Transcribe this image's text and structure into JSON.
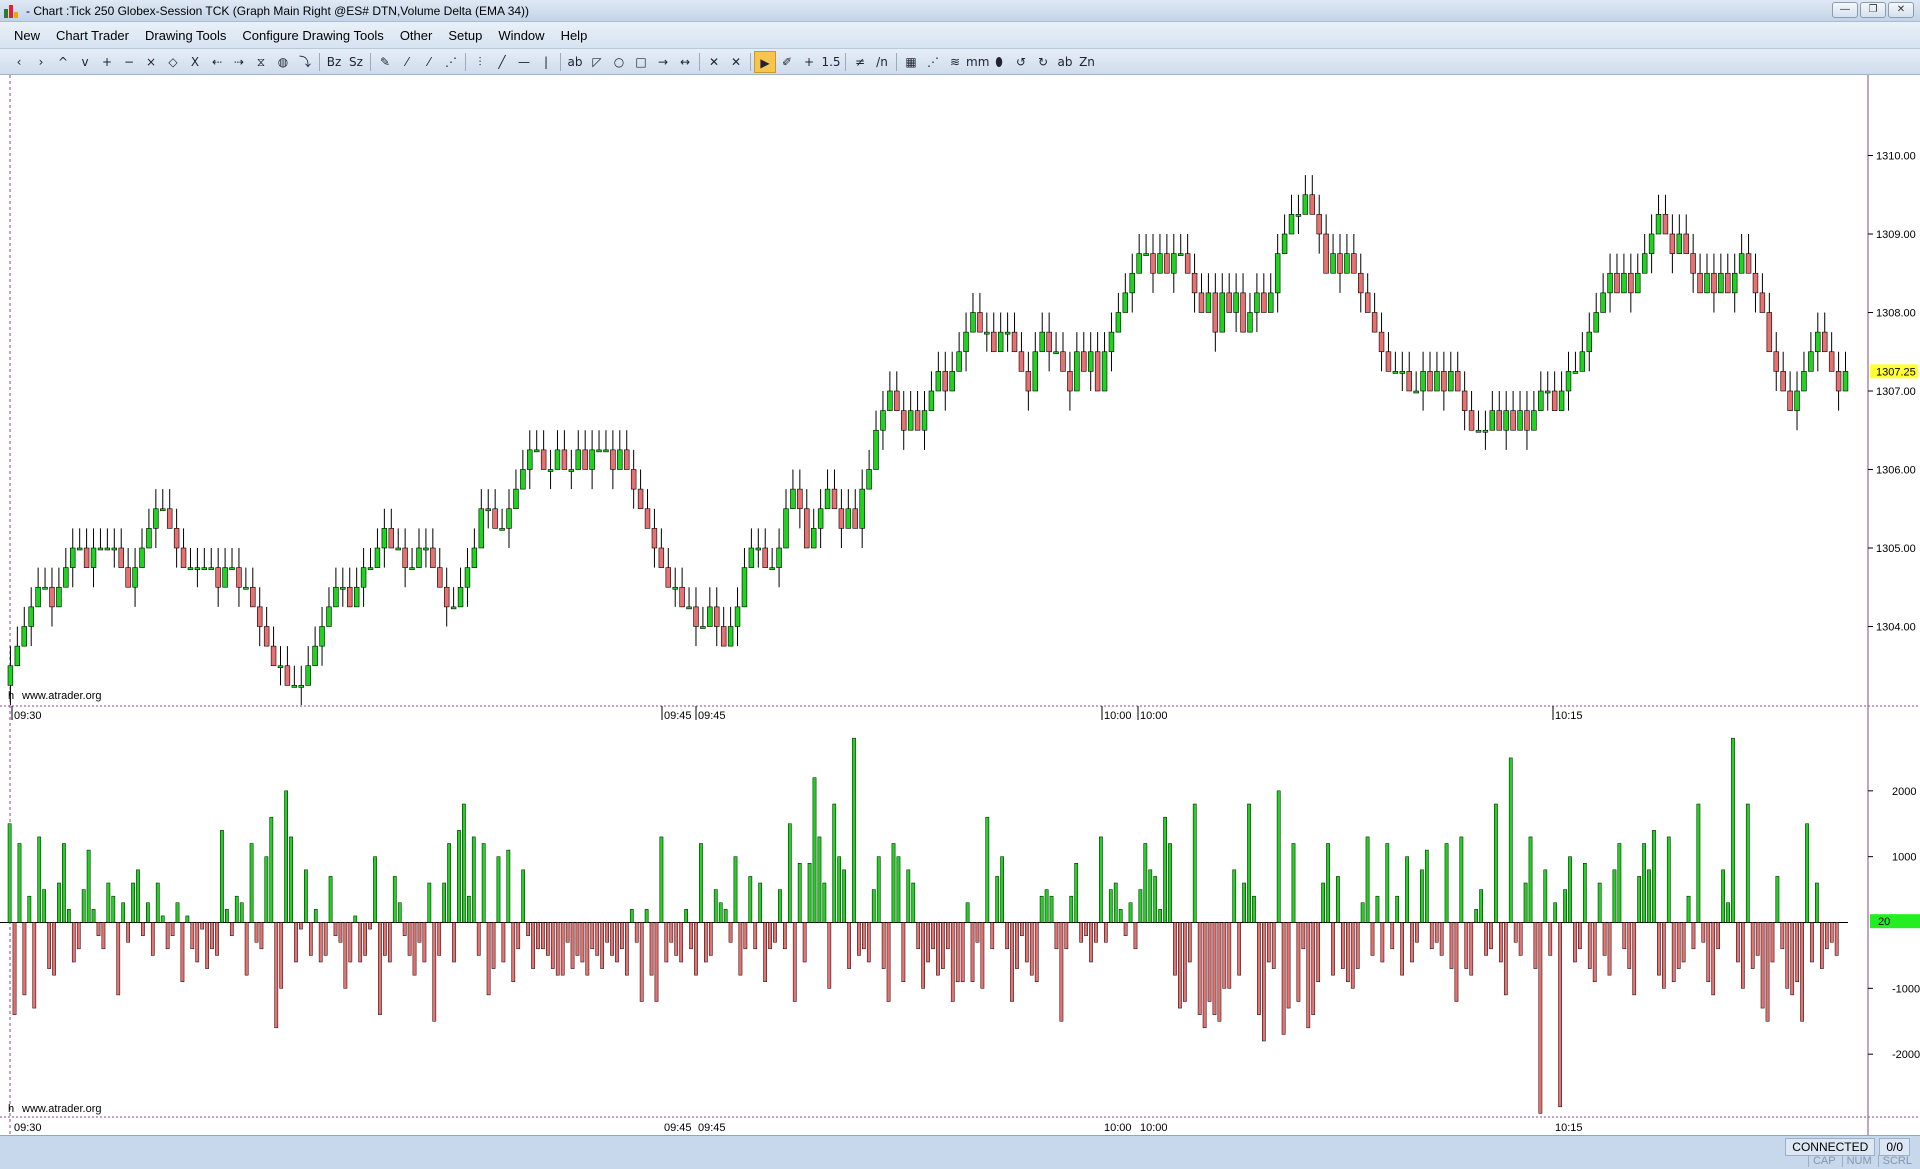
{
  "window": {
    "title": " - Chart :Tick  250 Globex-Session TCK (Graph Main Right @ES# DTN,Volume Delta (EMA 34))",
    "buttons": [
      "—",
      "❐",
      "✕"
    ]
  },
  "menu": {
    "items": [
      "New",
      "Chart Trader",
      "Drawing Tools",
      "Configure Drawing Tools",
      "Other",
      "Setup",
      "Window",
      "Help"
    ]
  },
  "toolbar": {
    "buttons": [
      "‹",
      "›",
      "^",
      "v",
      "+",
      "−",
      "×",
      "◇",
      "X",
      "⇠",
      "⇢",
      "⧖",
      "◍",
      "⤵",
      "Bz",
      "Sz",
      "✎",
      "⁄",
      "⁄",
      "⋰",
      "⫶",
      "╱",
      "—",
      "|",
      "ab",
      "◸",
      "○",
      "□",
      "→",
      "↔",
      "✕",
      "✕",
      "▶",
      "✐",
      "+",
      "1.5",
      "≠",
      "/n",
      "▦",
      "⋰",
      "≋",
      "mm",
      "⬮",
      "↺",
      "↻",
      "ab",
      "Zn"
    ],
    "active_index": 32
  },
  "price_panel": {
    "watermark": "www.atrader.org",
    "watermark_prefix": "h",
    "price_labels": [
      "1310.00",
      "1309.00",
      "1308.00",
      "1307.00",
      "1306.00",
      "1305.00",
      "1304.00"
    ],
    "current_price": "1307.25",
    "time_labels": [
      "09:30",
      "09:45",
      "09:45",
      "10:00",
      "10:00",
      "10:15"
    ],
    "colors": {
      "up": "#1ed41e",
      "down": "#e87070",
      "wick": "#000000",
      "current_bg": "#ffff33"
    }
  },
  "delta_panel": {
    "watermark": "www.atrader.org",
    "watermark_prefix": "h",
    "labels": [
      "2000",
      "1000",
      "-1000",
      "-2000"
    ],
    "current_value": "20",
    "time_labels": [
      "09:30",
      "09:45",
      "09:45",
      "10:00",
      "10:00",
      "10:15"
    ],
    "colors": {
      "positive": "#1ed41e",
      "negative": "#e87070",
      "current_bg": "#22ee22"
    }
  },
  "chart_data": [
    {
      "type": "candlestick",
      "title": "",
      "ylim": [
        1303.0,
        1311.0
      ],
      "close_sequence": [
        1303.5,
        1303.75,
        1304.0,
        1304.25,
        1304.5,
        1304.5,
        1304.25,
        1304.5,
        1304.75,
        1305.0,
        1305.0,
        1304.75,
        1305.0,
        1305.0,
        1305.0,
        1305.0,
        1304.75,
        1304.5,
        1304.75,
        1305.0,
        1305.25,
        1305.5,
        1305.5,
        1305.25,
        1305.0,
        1304.75,
        1304.75,
        1304.75,
        1304.75,
        1304.75,
        1304.5,
        1304.75,
        1304.75,
        1304.5,
        1304.5,
        1304.25,
        1304.0,
        1303.75,
        1303.5,
        1303.5,
        1303.25,
        1303.25,
        1303.25,
        1303.5,
        1303.75,
        1304.0,
        1304.25,
        1304.5,
        1304.5,
        1304.25,
        1304.5,
        1304.75,
        1304.75,
        1305.0,
        1305.25,
        1305.0,
        1305.0,
        1304.75,
        1304.75,
        1305.0,
        1305.0,
        1304.75,
        1304.5,
        1304.25,
        1304.25,
        1304.5,
        1304.75,
        1305.0,
        1305.5,
        1305.5,
        1305.25,
        1305.25,
        1305.5,
        1305.75,
        1306.0,
        1306.25,
        1306.25,
        1306.0,
        1306.0,
        1306.25,
        1306.0,
        1306.0,
        1306.25,
        1306.0,
        1306.25,
        1306.25,
        1306.25,
        1306.0,
        1306.25,
        1306.0,
        1305.75,
        1305.5,
        1305.25,
        1305.0,
        1304.75,
        1304.5,
        1304.5,
        1304.25,
        1304.25,
        1304.0,
        1304.0,
        1304.25,
        1304.0,
        1303.75,
        1304.0,
        1304.25,
        1304.75,
        1305.0,
        1305.0,
        1304.75,
        1304.75,
        1305.0,
        1305.5,
        1305.75,
        1305.5,
        1305.0,
        1305.25,
        1305.5,
        1305.75,
        1305.5,
        1305.25,
        1305.5,
        1305.25,
        1305.75,
        1306.0,
        1306.5,
        1306.75,
        1307.0,
        1306.75,
        1306.5,
        1306.75,
        1306.5,
        1306.75,
        1307.0,
        1307.25,
        1307.0,
        1307.25,
        1307.5,
        1307.75,
        1308.0,
        1307.75,
        1307.75,
        1307.5,
        1307.75,
        1307.75,
        1307.5,
        1307.25,
        1307.0,
        1307.5,
        1307.75,
        1307.5,
        1307.5,
        1307.25,
        1307.0,
        1307.5,
        1307.25,
        1307.5,
        1307.0,
        1307.5,
        1307.75,
        1308.0,
        1308.25,
        1308.5,
        1308.75,
        1308.75,
        1308.5,
        1308.75,
        1308.5,
        1308.75,
        1308.75,
        1308.5,
        1308.25,
        1308.0,
        1308.25,
        1307.75,
        1308.25,
        1308.0,
        1308.25,
        1307.75,
        1308.0,
        1308.25,
        1308.0,
        1308.25,
        1308.75,
        1309.0,
        1309.25,
        1309.25,
        1309.5,
        1309.25,
        1309.0,
        1308.5,
        1308.75,
        1308.5,
        1308.75,
        1308.5,
        1308.25,
        1308.0,
        1307.75,
        1307.5,
        1307.25,
        1307.25,
        1307.25,
        1307.0,
        1307.0,
        1307.25,
        1307.0,
        1307.25,
        1307.0,
        1307.25,
        1307.0,
        1306.75,
        1306.5,
        1306.5,
        1306.5,
        1306.75,
        1306.5,
        1306.75,
        1306.5,
        1306.75,
        1306.5,
        1306.75,
        1307.0,
        1307.0,
        1306.75,
        1307.0,
        1307.25,
        1307.25,
        1307.5,
        1307.75,
        1308.0,
        1308.25,
        1308.5,
        1308.25,
        1308.5,
        1308.25,
        1308.5,
        1308.75,
        1309.0,
        1309.25,
        1309.0,
        1308.75,
        1309.0,
        1308.75,
        1308.5,
        1308.25,
        1308.5,
        1308.25,
        1308.5,
        1308.25,
        1308.5,
        1308.75,
        1308.5,
        1308.25,
        1308.0,
        1307.5,
        1307.25,
        1307.0,
        1306.75,
        1307.0,
        1307.25,
        1307.5,
        1307.75,
        1307.5,
        1307.25,
        1307.0,
        1307.25
      ]
    },
    {
      "type": "bar",
      "title": "",
      "ylim": [
        -3000,
        3000
      ],
      "values": [
        1500,
        -1400,
        1200,
        -1100,
        400,
        -1300,
        1300,
        500,
        -700,
        -800,
        600,
        1200,
        200,
        -600,
        -400,
        500,
        1100,
        200,
        -200,
        -400,
        600,
        400,
        -1100,
        300,
        -300,
        600,
        800,
        -200,
        300,
        -500,
        600,
        100,
        -400,
        -200,
        300,
        -900,
        100,
        -400,
        -600,
        -100,
        -700,
        -400,
        -500,
        1400,
        200,
        -200,
        400,
        300,
        -800,
        1200,
        -300,
        -400,
        1000,
        1600,
        -1600,
        -1000,
        2000,
        1300,
        -600,
        -100,
        800,
        -500,
        200,
        -600,
        -500,
        700,
        -200,
        -300,
        -1000,
        -600,
        100,
        -600,
        -500,
        -100,
        1000,
        -1400,
        -500,
        -600,
        700,
        300,
        -200,
        -500,
        -800,
        -300,
        -600,
        600,
        -1500,
        -500,
        600,
        1200,
        -600,
        1400,
        1800,
        400,
        1300,
        -500,
        1200,
        -1100,
        -700,
        1000,
        -600,
        1100,
        -900,
        -400,
        800,
        -200,
        -700,
        -400,
        -400,
        -500,
        -700,
        -800,
        -800,
        -300,
        -700,
        -500,
        -600,
        -800,
        -400,
        -500,
        -700,
        -300,
        -500,
        -600,
        -400,
        -800,
        200,
        -300,
        -1200,
        200,
        -800,
        -1200,
        1300,
        -600,
        -300,
        -500,
        -600,
        200,
        -400,
        -800,
        1200,
        -600,
        -500,
        500,
        300,
        200,
        -300,
        1000,
        -800,
        -400,
        700,
        -400,
        600,
        -900,
        -400,
        -300,
        500,
        -400,
        1500,
        -1200,
        900,
        -600,
        900,
        2200,
        1300,
        600,
        -1000,
        1800,
        1000,
        800,
        -700,
        2800,
        -500,
        -400,
        -600,
        500,
        1000,
        -700,
        -1200,
        1200,
        1000,
        -900,
        800,
        600,
        -400,
        -1000,
        -600,
        -400,
        -800,
        -700,
        -400,
        -1200,
        -900,
        -900,
        300,
        -900,
        -300,
        -1000,
        1600,
        -400,
        700,
        1000,
        -400,
        -1200,
        -700,
        -200,
        -600,
        -800,
        -900,
        400,
        500,
        400,
        -400,
        -1500,
        -400,
        400,
        900,
        -300,
        -200,
        -600,
        -300,
        1300,
        -300,
        500,
        600,
        200,
        -200,
        300,
        -400,
        500,
        1200,
        800,
        700,
        200,
        1600,
        1200,
        -800,
        -1300,
        -1200,
        -600,
        1800,
        -1400,
        -1600,
        -1200,
        -1400,
        -1500,
        -1000,
        -1000,
        800,
        -800,
        600,
        1800,
        400,
        -1400,
        -1800,
        -600,
        -700,
        2000,
        -1700,
        -1300,
        1200,
        -1200,
        -400,
        -1600,
        -1400,
        -900,
        600,
        1200,
        -800,
        700,
        -700,
        -900,
        -1000,
        -700,
        300,
        1300,
        -500,
        400,
        -600,
        1200,
        -400,
        400,
        -800,
        1000,
        -600,
        -300,
        800,
        1100,
        -400,
        -300,
        -500,
        1200,
        -700,
        -1200,
        1300,
        -700,
        -800,
        200,
        500,
        -500,
        -400,
        1800,
        -600,
        -1100,
        2500,
        -300,
        -500,
        600,
        1300,
        -700,
        -2900,
        800,
        -500,
        300,
        -2800,
        500,
        1000,
        -600,
        -400,
        900,
        -700,
        -900,
        600,
        -500,
        -800,
        800,
        1200,
        -400,
        -700,
        -1100,
        700,
        1200,
        800,
        1400,
        -800,
        -1000,
        1300,
        -900,
        -700,
        -600,
        400,
        -400,
        1800,
        -300,
        -900,
        -1100,
        -400,
        800,
        300,
        2800,
        -600,
        -1000,
        1800,
        -700,
        -500,
        -1300,
        -1500,
        -600,
        700,
        -400,
        -1000,
        -1100,
        -900,
        -1500,
        1500,
        -600,
        600,
        -700,
        -400,
        -300,
        -500
      ]
    }
  ],
  "status": {
    "connection": "CONNECTED",
    "count": "0/0",
    "keys": [
      "CAP",
      "NUM",
      "SCRL"
    ]
  }
}
